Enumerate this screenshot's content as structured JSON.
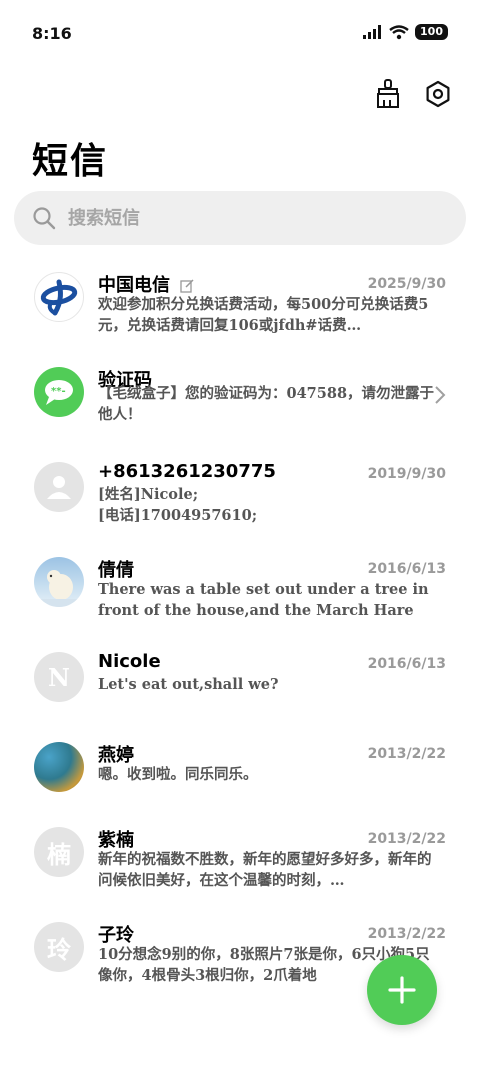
{
  "status_bar": {
    "time": "8:16",
    "battery": "100"
  },
  "page": {
    "title": "短信"
  },
  "search": {
    "placeholder": "搜索短信"
  },
  "messages": [
    {
      "name": "中国电信",
      "date": "2025/9/30",
      "preview": "欢迎参加积分兑换话费活动，每500分可兑换话费5元，兑换话费请回复106或jfdh#话费…",
      "avatar": "china-telecom-logo"
    },
    {
      "name": "验证码",
      "date": "",
      "preview": "【毛绒盒子】您的验证码为：047588，请勿泄露于他人！",
      "avatar": "sms-code-icon"
    },
    {
      "name": "+8613261230775",
      "date": "2019/9/30",
      "preview": "[姓名]Nicole;\n[电话]17004957610;",
      "avatar": "person-icon"
    },
    {
      "name": "倩倩",
      "date": "2016/6/13",
      "preview": "There was a table set out under a tree in front of the house,and the March Hare a…",
      "avatar": "polar-bear-photo"
    },
    {
      "name": "Nicole",
      "date": "2016/6/13",
      "preview": "Let's eat out,shall we?",
      "avatar_letter": "N"
    },
    {
      "name": "燕婷",
      "date": "2013/2/22",
      "preview": "嗯。收到啦。同乐同乐。",
      "avatar": "landscape-photo"
    },
    {
      "name": "紫楠",
      "date": "2013/2/22",
      "preview": "新年的祝福数不胜数，新年的愿望好多好多，新年的问候依旧美好，在这个温馨的时刻，…",
      "avatar_letter": "楠"
    },
    {
      "name": "子玲",
      "date": "2013/2/22",
      "preview": "10分想念9别的你，8张照片7张是你，6只小狗5只像你，4根骨头3根归你，2爪着地",
      "avatar_letter": "玲"
    }
  ],
  "colors": {
    "accent": "#51cc57",
    "telecom_blue": "#1b4fa0"
  }
}
